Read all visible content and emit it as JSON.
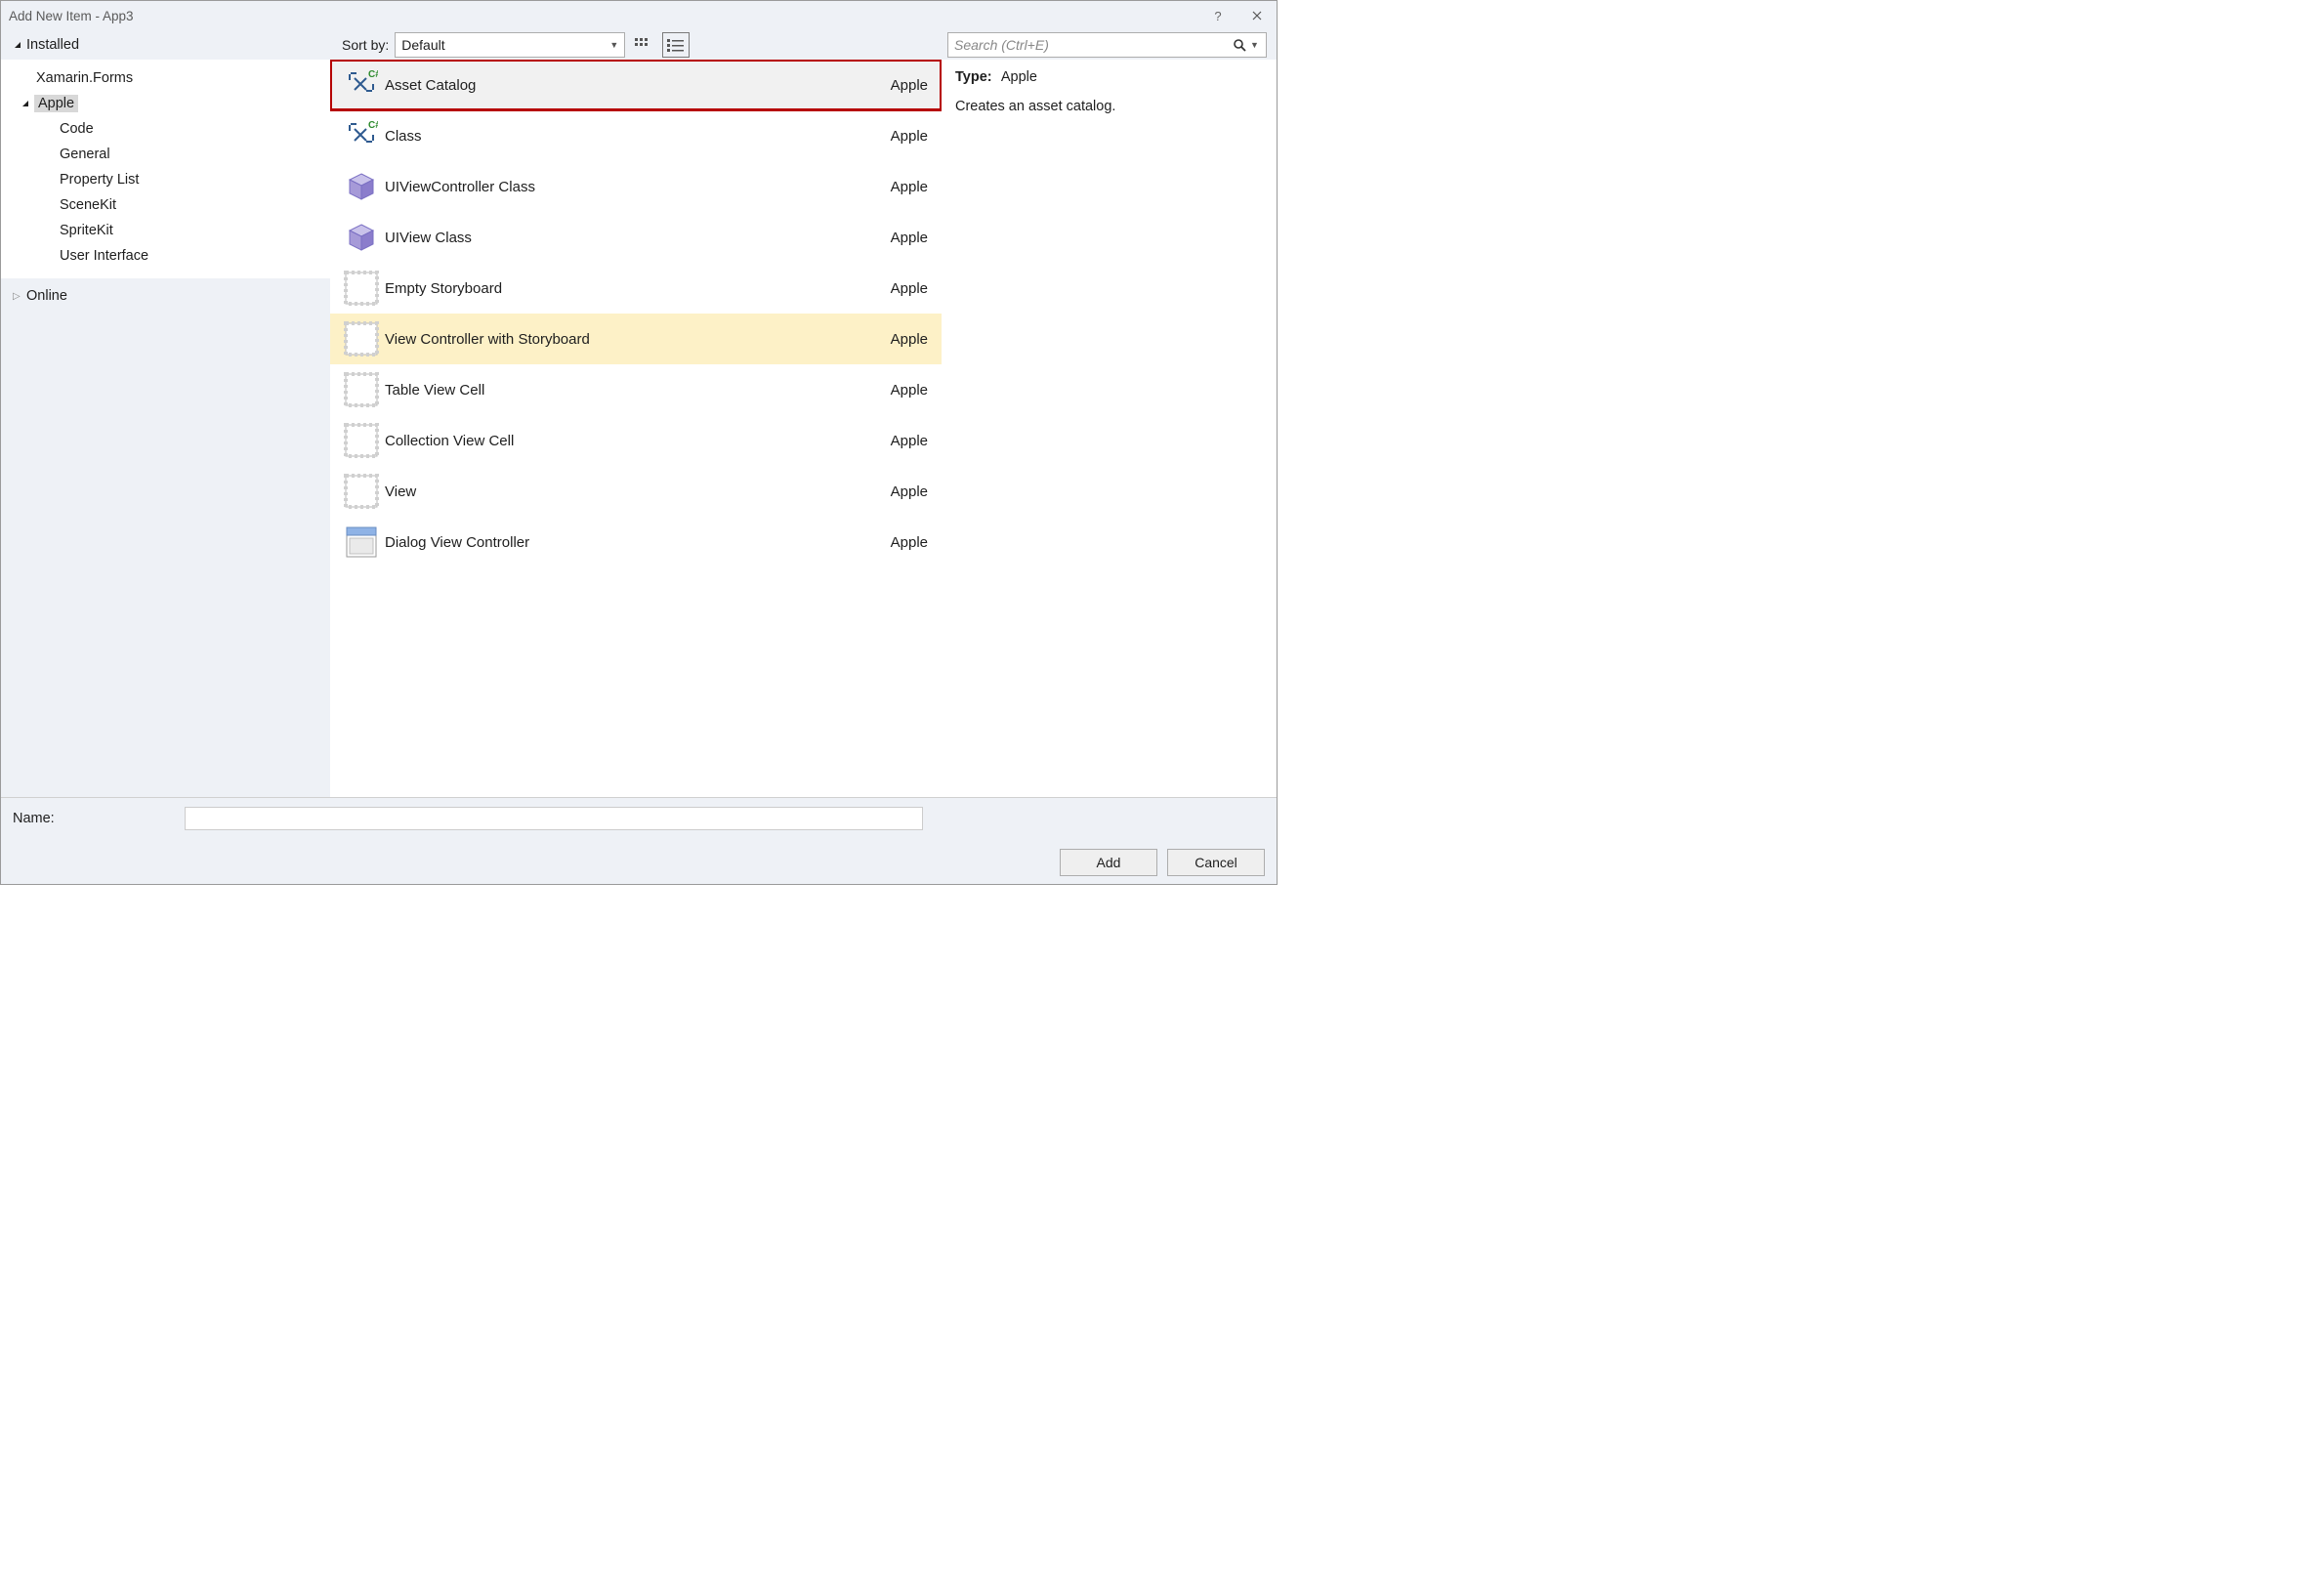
{
  "titlebar": {
    "title": "Add New Item - App3"
  },
  "sidebar": {
    "header": "Installed",
    "onlineLabel": "Online",
    "items": [
      {
        "label": "Xamarin.Forms",
        "level": 1,
        "expandable": false,
        "selected": false
      },
      {
        "label": "Apple",
        "level": 1,
        "expandable": true,
        "selected": true
      },
      {
        "label": "Code",
        "level": 2,
        "expandable": false,
        "selected": false
      },
      {
        "label": "General",
        "level": 2,
        "expandable": false,
        "selected": false
      },
      {
        "label": "Property List",
        "level": 2,
        "expandable": false,
        "selected": false
      },
      {
        "label": "SceneKit",
        "level": 2,
        "expandable": false,
        "selected": false
      },
      {
        "label": "SpriteKit",
        "level": 2,
        "expandable": false,
        "selected": false
      },
      {
        "label": "User Interface",
        "level": 2,
        "expandable": false,
        "selected": false
      }
    ]
  },
  "toolbar": {
    "sortLabel": "Sort by:",
    "sortValue": "Default",
    "searchPlaceholder": "Search (Ctrl+E)"
  },
  "templates": [
    {
      "name": "Asset Catalog",
      "category": "Apple",
      "icon": "cs",
      "state": "selected-red"
    },
    {
      "name": "Class",
      "category": "Apple",
      "icon": "cs",
      "state": ""
    },
    {
      "name": "UIViewController Class",
      "category": "Apple",
      "icon": "cube",
      "state": ""
    },
    {
      "name": "UIView Class",
      "category": "Apple",
      "icon": "cube",
      "state": ""
    },
    {
      "name": "Empty Storyboard",
      "category": "Apple",
      "icon": "sb",
      "state": ""
    },
    {
      "name": "View Controller with Storyboard",
      "category": "Apple",
      "icon": "sb",
      "state": "hover"
    },
    {
      "name": "Table View Cell",
      "category": "Apple",
      "icon": "sb",
      "state": ""
    },
    {
      "name": "Collection View Cell",
      "category": "Apple",
      "icon": "sb",
      "state": ""
    },
    {
      "name": "View",
      "category": "Apple",
      "icon": "sb",
      "state": ""
    },
    {
      "name": "Dialog View Controller",
      "category": "Apple",
      "icon": "dlg",
      "state": ""
    }
  ],
  "details": {
    "typeLabel": "Type:",
    "typeValue": "Apple",
    "description": "Creates an asset catalog."
  },
  "bottom": {
    "nameLabel": "Name:",
    "nameValue": "",
    "addLabel": "Add",
    "cancelLabel": "Cancel"
  }
}
